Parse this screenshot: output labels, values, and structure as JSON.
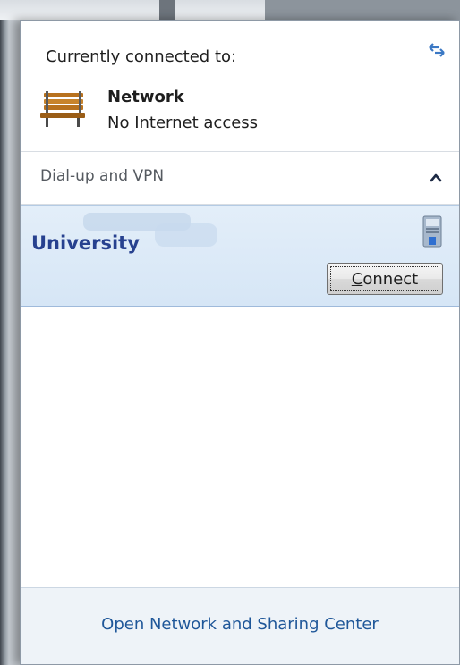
{
  "flyout": {
    "connected_title": "Currently connected to:",
    "network": {
      "name": "Network",
      "status": "No Internet access"
    },
    "dialup": {
      "label": "Dial-up and VPN",
      "expanded": true
    },
    "vpn_item": {
      "name": "University",
      "connect_label": "Connect"
    },
    "footer_link": "Open Network and Sharing Center"
  },
  "icons": {
    "refresh": "refresh-arrows-icon",
    "network": "park-bench-icon",
    "collapse": "chevron-up-icon",
    "vpn": "vpn-connection-icon"
  },
  "colors": {
    "vpn_name": "#27418f",
    "selected_bg": "#dbe9f7",
    "footer_link": "#1f5799",
    "footer_bg": "#eef3f8"
  }
}
